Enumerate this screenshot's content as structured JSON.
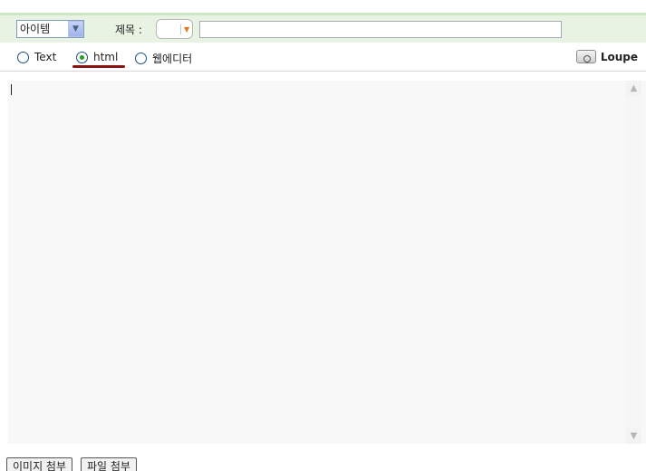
{
  "toolbar": {
    "category_select": {
      "value": "아이템"
    },
    "title_label": "제목 :",
    "title_input": {
      "value": ""
    }
  },
  "modes": {
    "options": [
      {
        "label": "Text",
        "selected": false
      },
      {
        "label": "html",
        "selected": true
      },
      {
        "label": "웹에디터",
        "selected": false
      }
    ],
    "loupe_label": "Loupe"
  },
  "editor": {
    "content": ""
  },
  "footer": {
    "attach_image_label": "이미지 첨부",
    "attach_file_label": "파일 첨부"
  },
  "colors": {
    "toolbar_bg": "#e9f3e4",
    "selected_radio": "#21a121",
    "underline_mark": "#8b1212"
  }
}
